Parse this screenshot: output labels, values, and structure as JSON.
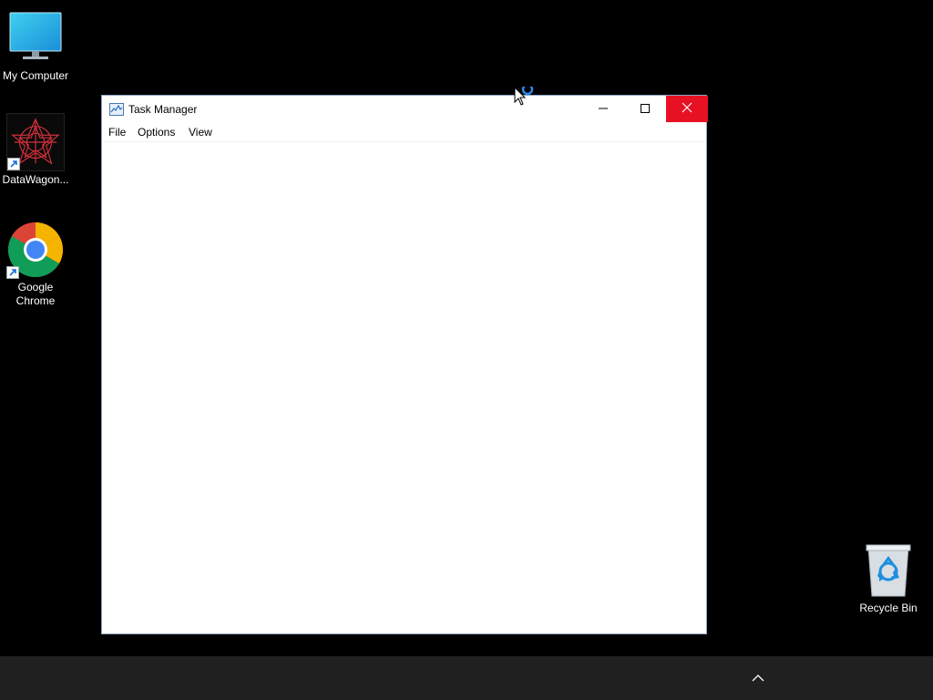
{
  "desktop": {
    "icons": [
      {
        "label": "My Computer",
        "icon": "monitor-icon"
      },
      {
        "label": "DataWagon...",
        "icon": "datawagon-logo-icon"
      },
      {
        "label": "Google Chrome",
        "icon": "chrome-icon"
      },
      {
        "label": "Recycle Bin",
        "icon": "recycle-bin-icon"
      }
    ]
  },
  "window": {
    "title": "Task Manager",
    "app_icon": "task-manager-icon",
    "menu": [
      "File",
      "Options",
      "View"
    ],
    "controls": [
      "minimize-icon",
      "maximize-icon",
      "close-icon"
    ]
  },
  "taskbar": {
    "tray": "chevron-up-icon"
  },
  "colors": {
    "close_button": "#e81123",
    "taskbar": "#202020",
    "desktop": "#000000"
  }
}
